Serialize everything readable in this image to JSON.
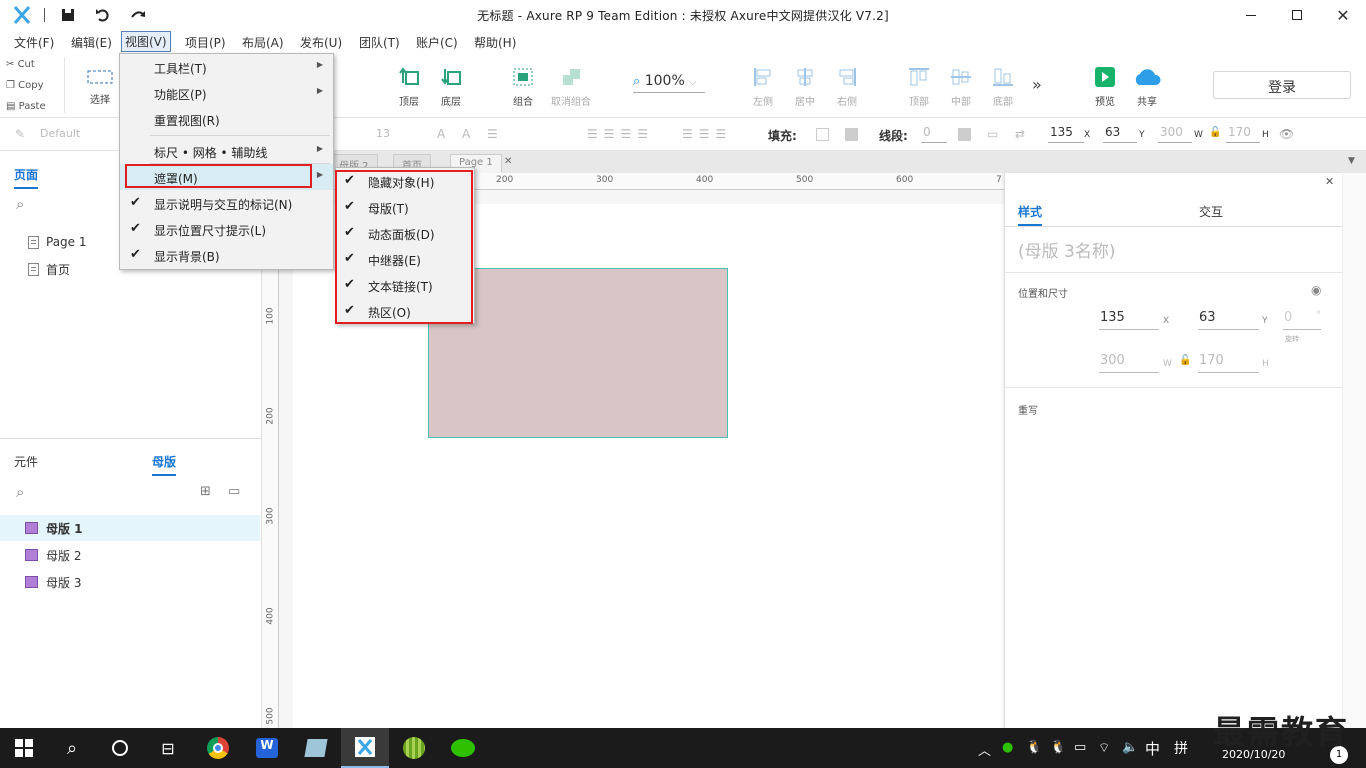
{
  "window": {
    "title": "无标题 - Axure RP 9 Team Edition : 未授权    Axure中文网提供汉化 V7.2]"
  },
  "menubar": [
    "文件(F)",
    "编辑(E)",
    "视图(V)",
    "项目(P)",
    "布局(A)",
    "发布(U)",
    "团队(T)",
    "账户(C)",
    "帮助(H)"
  ],
  "clipboard": {
    "cut": "Cut",
    "copy": "Copy",
    "paste": "Paste"
  },
  "toolbar": {
    "select": "选择",
    "top": "顶层",
    "bottom": "底层",
    "group": "组合",
    "ungroup": "取消组合",
    "zoom": "100%",
    "left": "左侧",
    "center": "居中",
    "right": "右侧",
    "vtop": "顶部",
    "vmid": "中部",
    "vbot": "底部",
    "preview": "预览",
    "share": "共享",
    "login": "登录"
  },
  "formatbar": {
    "style": "Default",
    "fontsize": "13",
    "fill": "填充:",
    "stroke": "线段:",
    "stroke_w": "0",
    "x": "135",
    "y": "63",
    "w": "300",
    "h": "170",
    "x_lbl": "X",
    "y_lbl": "Y",
    "w_lbl": "W",
    "h_lbl": "H"
  },
  "left_panel": {
    "pages_tab": "页面",
    "pages": [
      "Page 1",
      "首页"
    ],
    "components_tab": "元件",
    "masters_tab": "母版",
    "masters": [
      "母版 1",
      "母版 2",
      "母版 3"
    ]
  },
  "doc_tabs": [
    "母版 2",
    "首页",
    "Page 1"
  ],
  "ruler": {
    "h": [
      "200",
      "300",
      "400",
      "500",
      "600",
      "7"
    ],
    "v": [
      "100",
      "200",
      "300",
      "400",
      "500"
    ]
  },
  "view_menu": [
    {
      "label": "工具栏(T)",
      "submenu": true,
      "checked": false
    },
    {
      "label": "功能区(P)",
      "submenu": true,
      "checked": false
    },
    {
      "label": "重置视图(R)",
      "submenu": false,
      "checked": false
    },
    {
      "label": "标尺 • 网格 • 辅助线",
      "submenu": true,
      "checked": false
    },
    {
      "label": "遮罩(M)",
      "submenu": true,
      "checked": false
    },
    {
      "label": "显示说明与交互的标记(N)",
      "submenu": false,
      "checked": true
    },
    {
      "label": "显示位置尺寸提示(L)",
      "submenu": false,
      "checked": true
    },
    {
      "label": "显示背景(B)",
      "submenu": false,
      "checked": true
    }
  ],
  "mask_submenu": [
    "隐藏对象(H)",
    "母版(T)",
    "动态面板(D)",
    "中继器(E)",
    "文本链接(T)",
    "热区(O)"
  ],
  "right_panel": {
    "style_tab": "样式",
    "interaction_tab": "交互",
    "name_placeholder": "(母版 3名称)",
    "pos_size": "位置和尺寸",
    "x": "135",
    "y": "63",
    "rot": "0",
    "w": "300",
    "h": "170",
    "x_lbl": "X",
    "y_lbl": "Y",
    "w_lbl": "W",
    "h_lbl": "H",
    "rot_lbl": "旋转",
    "deg": "°",
    "override": "重写"
  },
  "taskbar": {
    "time": "2020/10/20",
    "ime": "中",
    "ime2": "拼",
    "notif": "1"
  },
  "watermark": "最需教育",
  "colors": {
    "accent": "#1976d2",
    "shape_fill": "#d9c5c5",
    "shape_border": "#47c1b5",
    "highlight": "#e02020"
  }
}
